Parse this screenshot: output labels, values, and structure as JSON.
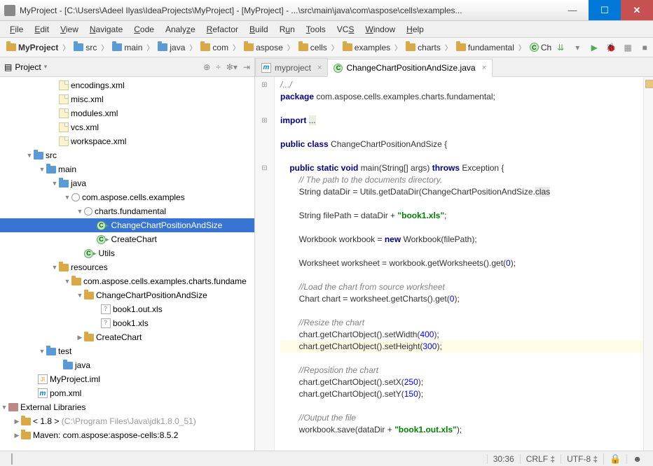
{
  "title": "MyProject - [C:\\Users\\Adeel Ilyas\\IdeaProjects\\MyProject] - [MyProject] - ...\\src\\main\\java\\com\\aspose\\cells\\examples...",
  "menu": [
    "File",
    "Edit",
    "View",
    "Navigate",
    "Code",
    "Analyze",
    "Refactor",
    "Build",
    "Run",
    "Tools",
    "VCS",
    "Window",
    "Help"
  ],
  "crumbs": [
    "MyProject",
    "src",
    "main",
    "java",
    "com",
    "aspose",
    "cells",
    "examples",
    "charts",
    "fundamental",
    "Ch"
  ],
  "sidebar_title": "Project",
  "tree": {
    "encodings": "encodings.xml",
    "misc": "misc.xml",
    "modules": "modules.xml",
    "vcs": "vcs.xml",
    "workspace": "workspace.xml",
    "src": "src",
    "main": "main",
    "java": "java",
    "pkg1": "com.aspose.cells.examples",
    "pkg2": "charts.fundamental",
    "cls1": "ChangeChartPositionAndSize",
    "cls2": "CreateChart",
    "cls3": "Utils",
    "resources": "resources",
    "pkg3": "com.aspose.cells.examples.charts.fundame",
    "fold1": "ChangeChartPositionAndSize",
    "file1": "book1.out.xls",
    "file2": "book1.xls",
    "fold2": "CreateChart",
    "test": "test",
    "tjava": "java",
    "iml": "MyProject.iml",
    "pom": "pom.xml",
    "ext": "External Libraries",
    "jdk": "< 1.8 >",
    "jdkpath": "(C:\\Program Files\\Java\\jdk1.8.0_51)",
    "maven": "Maven: com.aspose:aspose-cells:8.5.2"
  },
  "tabs": {
    "t1": "myproject",
    "t2": "ChangeChartPositionAndSize.java"
  },
  "code": {
    "l1": "/.../",
    "l2a": "package",
    "l2b": " com.aspose.cells.examples.charts.fundamental;",
    "l3a": "import ",
    "l3b": "...",
    "l4a": "public class ",
    "l4b": "ChangeChartPositionAndSize {",
    "l5a": "    public static void ",
    "l5b": "main(String[] args) ",
    "l5c": "throws ",
    "l5d": "Exception {",
    "l6": "        // The path to the documents directory.",
    "l7a": "        String dataDir = Utils.getDataDir(ChangeChartPositionAndSize.",
    "l7b": "clas",
    "l8a": "        String filePath = dataDir + ",
    "l8b": "\"book1.xls\"",
    "l8c": ";",
    "l9a": "        Workbook workbook = ",
    "l9b": "new ",
    "l9c": "Workbook(filePath);",
    "l10a": "        Worksheet worksheet = workbook.getWorksheets().get(",
    "l10b": "0",
    "l10c": ");",
    "l11": "        //Load the chart from source worksheet",
    "l12a": "        Chart chart = worksheet.getCharts().get(",
    "l12b": "0",
    "l12c": ");",
    "l13": "        //Resize the chart",
    "l14a": "        chart.getChartObject().setWidth(",
    "l14b": "400",
    "l14c": ");",
    "l15a": "        chart.getChartObject().setHeight(",
    "l15b": "300",
    "l15c": ");",
    "l16": "        //Reposition the chart",
    "l17a": "        chart.getChartObject().setX(",
    "l17b": "250",
    "l17c": ");",
    "l18a": "        chart.getChartObject().setY(",
    "l18b": "150",
    "l18c": ");",
    "l19": "        //Output the file",
    "l20a": "        workbook.save(dataDir + ",
    "l20b": "\"book1.out.xls\"",
    "l20c": ");"
  },
  "status": {
    "pos": "30:36",
    "eol": "CRLF",
    "sep": "‡",
    "enc": "UTF-8",
    "sep2": "‡"
  }
}
